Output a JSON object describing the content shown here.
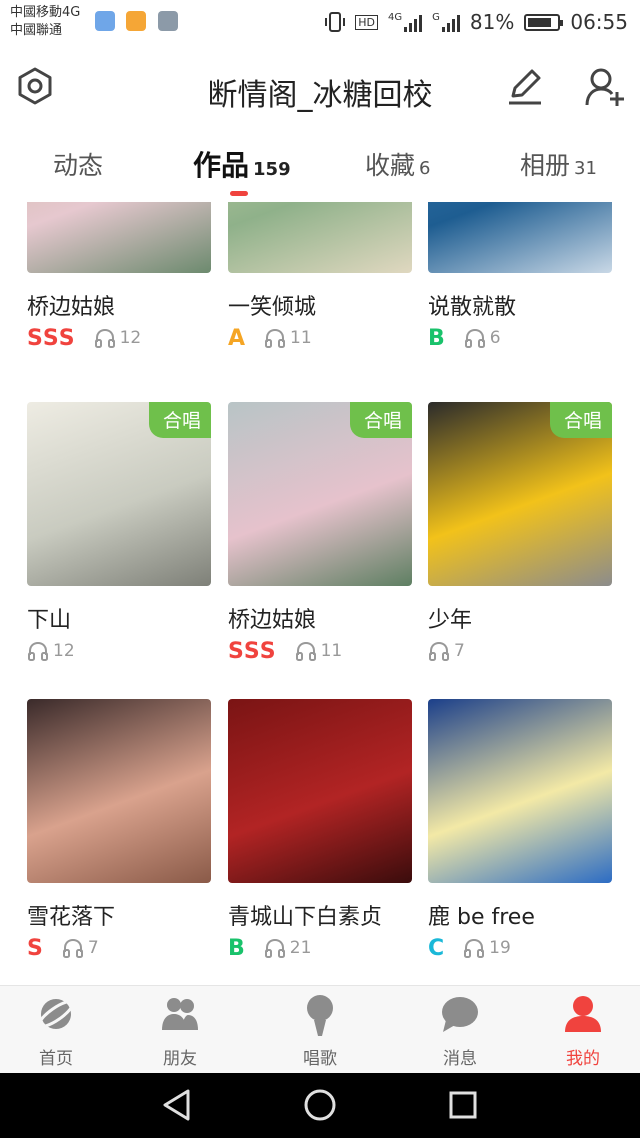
{
  "status_bar": {
    "carrier_line1": "中國移動4G",
    "carrier_line2": "中國聯通",
    "hd": "HD",
    "net_4g": "4G",
    "net_g": "G",
    "battery_percent": "81%",
    "battery_level": 0.81,
    "time": "06:55"
  },
  "header": {
    "title": "断情阁_冰糖回校"
  },
  "tabs": [
    {
      "label": "动态",
      "count": ""
    },
    {
      "label": "作品",
      "count": "159"
    },
    {
      "label": "收藏",
      "count": "6"
    },
    {
      "label": "相册",
      "count": "31"
    }
  ],
  "works": [
    {
      "title": "桥边姑娘",
      "grade": "SSS",
      "grade_color": "#f0433e",
      "plays": "12",
      "chorus": "",
      "cover_colors": [
        "#c8b49a",
        "#e6c8cf",
        "#6c8a6e"
      ]
    },
    {
      "title": "一笑倾城",
      "grade": "A",
      "grade_color": "#f5a524",
      "plays": "11",
      "chorus": "",
      "cover_colors": [
        "#c9d3a8",
        "#8fb18a",
        "#e0d8c0"
      ]
    },
    {
      "title": "说散就散",
      "grade": "B",
      "grade_color": "#19c26b",
      "plays": "6",
      "chorus": "",
      "cover_colors": [
        "#3b7fb8",
        "#1e5d91",
        "#c9d8e6"
      ]
    },
    {
      "title": "下山",
      "grade": "",
      "grade_color": "",
      "plays": "12",
      "chorus": "合唱",
      "cover_colors": [
        "#eeece3",
        "#c9cbc0",
        "#7e8078"
      ]
    },
    {
      "title": "桥边姑娘",
      "grade": "SSS",
      "grade_color": "#f0433e",
      "plays": "11",
      "chorus": "合唱",
      "cover_colors": [
        "#b8c4c6",
        "#e6c2cc",
        "#5e7f62"
      ]
    },
    {
      "title": "少年",
      "grade": "",
      "grade_color": "",
      "plays": "7",
      "chorus": "合唱",
      "cover_colors": [
        "#2b2b2b",
        "#f2c21a",
        "#8c8c8c"
      ]
    },
    {
      "title": "雪花落下",
      "grade": "S",
      "grade_color": "#f0433e",
      "plays": "7",
      "chorus": "",
      "cover_colors": [
        "#3a2a2a",
        "#d9a28d",
        "#8a5a48"
      ]
    },
    {
      "title": "青城山下白素贞",
      "grade": "B",
      "grade_color": "#19c26b",
      "plays": "21",
      "chorus": "",
      "cover_colors": [
        "#7a1414",
        "#b22424",
        "#3a0c0c"
      ]
    },
    {
      "title": "鹿 be free",
      "grade": "C",
      "grade_color": "#1ab8d8",
      "plays": "19",
      "chorus": "",
      "cover_colors": [
        "#1b3f8a",
        "#f3e9a6",
        "#2c6cc4"
      ]
    }
  ],
  "bottom_nav": [
    {
      "label": "首页",
      "icon": "planet-icon"
    },
    {
      "label": "朋友",
      "icon": "friends-icon"
    },
    {
      "label": "唱歌",
      "icon": "microphone-icon"
    },
    {
      "label": "消息",
      "icon": "chat-bubble-icon"
    },
    {
      "label": "我的",
      "icon": "profile-icon"
    }
  ],
  "colors": {
    "accent": "#f0433e",
    "chorus_badge": "#6fc04b"
  }
}
